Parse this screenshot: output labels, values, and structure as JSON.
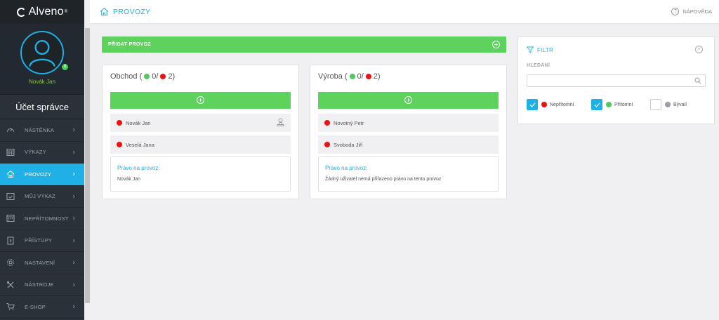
{
  "app": {
    "logo_text": "Alveno"
  },
  "profile": {
    "name": "Novák Jan",
    "status_badge": "8"
  },
  "account": {
    "title": "Účet správce"
  },
  "nav": [
    {
      "label": "NÁSTĚNKA",
      "icon": "gauge-icon",
      "active": false
    },
    {
      "label": "VÝKAZY",
      "icon": "calendar-grid-icon",
      "active": false
    },
    {
      "label": "PROVOZY",
      "icon": "home-icon",
      "active": true
    },
    {
      "label": "MŮJ VÝKAZ",
      "icon": "calendar-check-icon",
      "active": false
    },
    {
      "label": "NEPŘÍTOMNOST",
      "icon": "calendar-dots-icon",
      "active": false
    },
    {
      "label": "PŘÍSTUPY",
      "icon": "door-icon",
      "active": false
    },
    {
      "label": "NASTAVENÍ",
      "icon": "gear-icon",
      "active": false
    },
    {
      "label": "NÁSTROJE",
      "icon": "tools-icon",
      "active": false
    },
    {
      "label": "E-SHOP",
      "icon": "cart-icon",
      "active": false
    }
  ],
  "header": {
    "title": "PROVOZY",
    "help_label": "NÁPOVĚDA"
  },
  "add_provoz": {
    "label": "PŘIDAT PROVOZ"
  },
  "cards": [
    {
      "name": "Obchod",
      "title_prefix": "Obchod (",
      "present_count": "0/",
      "absent_count": "2)",
      "people": [
        {
          "name": "Novák Jan",
          "status": "absent"
        },
        {
          "name": "Veselá Jana",
          "status": "absent"
        }
      ],
      "rights_label": "Právo na provoz:",
      "rights_value": "Novák Jan"
    },
    {
      "name": "Výroba",
      "title_prefix": "Výroba (",
      "present_count": "0/",
      "absent_count": "2)",
      "people": [
        {
          "name": "Novotný Petr",
          "status": "absent"
        },
        {
          "name": "Svoboda Jiří",
          "status": "absent"
        }
      ],
      "rights_label": "Právo na provoz:",
      "rights_value": "Žádný uživatel nemá přiřazeno právo na tento provoz"
    }
  ],
  "filter": {
    "title": "FILTR",
    "search_label": "HLEDÁNÍ",
    "search_value": "",
    "search_placeholder": "",
    "options": [
      {
        "label": "Nepřítomní",
        "checked": true,
        "color": "#ee1111"
      },
      {
        "label": "Přítomní",
        "checked": true,
        "color": "#4fc85c"
      },
      {
        "label": "Bývalí",
        "checked": false,
        "color": "#9a9ea4"
      }
    ]
  },
  "colors": {
    "accent": "#1fb1e6",
    "green": "#5dd35d",
    "sidebar": "#2b3138"
  }
}
